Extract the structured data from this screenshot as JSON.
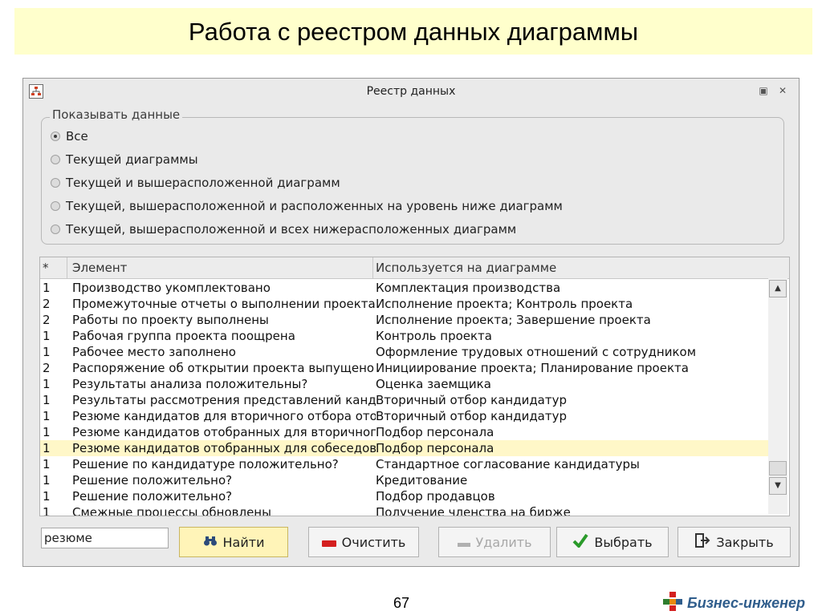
{
  "slide": {
    "title": "Работа с реестром данных диаграммы",
    "page_number": "67"
  },
  "dialog": {
    "title": "Реестр данных",
    "app_icon": "diagram-icon",
    "window_buttons": [
      "restore-icon",
      "close-icon"
    ]
  },
  "filter": {
    "group_label": "Показывать данные",
    "selected_index": 0,
    "options": [
      "Все",
      "Текущей диаграммы",
      "Текущей и вышерасположенной диаграмм",
      "Текущей, вышерасположенной и расположенных на уровень ниже диаграмм",
      "Текущей, вышерасположенной и всех нижерасположенных диаграмм"
    ]
  },
  "table": {
    "columns": [
      "*",
      "Элемент",
      "Используется на диаграмме"
    ],
    "highlighted_row": 10,
    "rows": [
      [
        "1",
        "Производство укомплектовано",
        "Комплектация производства"
      ],
      [
        "2",
        "Промежуточные отчеты о выполнении проекта",
        "Исполнение проекта; Контроль проекта"
      ],
      [
        "2",
        "Работы по проекту выполнены",
        "Исполнение проекта; Завершение проекта"
      ],
      [
        "1",
        "Рабочая группа проекта поощрена",
        "Контроль проекта"
      ],
      [
        "1",
        "Рабочее место заполнено",
        "Оформление трудовых отношений с сотрудником"
      ],
      [
        "2",
        "Распоряжение об открытии проекта выпущено",
        "Инициирование проекта; Планирование проекта"
      ],
      [
        "1",
        "Результаты анализа положительны?",
        "Оценка заемщика"
      ],
      [
        "1",
        "Результаты рассмотрения представлений кандидатов",
        "Вторичный отбор кандидатур"
      ],
      [
        "1",
        "Резюме кандидатов для вторичного отбора отобраны",
        "Вторичный отбор кандидатур"
      ],
      [
        "1",
        "Резюме кандидатов отобранных для вторичного",
        "Подбор персонала"
      ],
      [
        "1",
        "Резюме кандидатов отобранных для собеседования",
        "Подбор персонала"
      ],
      [
        "1",
        "Решение по кандидатуре положительно?",
        "Стандартное согласование кандидатуры"
      ],
      [
        "1",
        "Решение положительно?",
        "Кредитование"
      ],
      [
        "1",
        "Решение положительно?",
        "Подбор продавцов"
      ],
      [
        "1",
        "Смежные процессы обновлены",
        "Получение членства на бирже"
      ]
    ]
  },
  "search": {
    "value": "резюме"
  },
  "buttons": {
    "find": {
      "label": "Найти",
      "icon": "binoculars-icon"
    },
    "clear": {
      "label": "Очистить",
      "icon": "minus-red-icon"
    },
    "delete": {
      "label": "Удалить",
      "icon": "minus-gray-icon"
    },
    "select": {
      "label": "Выбрать",
      "icon": "checkmark-icon"
    },
    "close": {
      "label": "Закрыть",
      "icon": "exit-door-icon"
    }
  },
  "logo": {
    "text": "Бизнес-инженер"
  },
  "colors": {
    "title_band": "#ffffcc",
    "highlight_row": "#fff7c8",
    "find_button": "#fff4b8",
    "logo_text": "#2f5d8c"
  }
}
